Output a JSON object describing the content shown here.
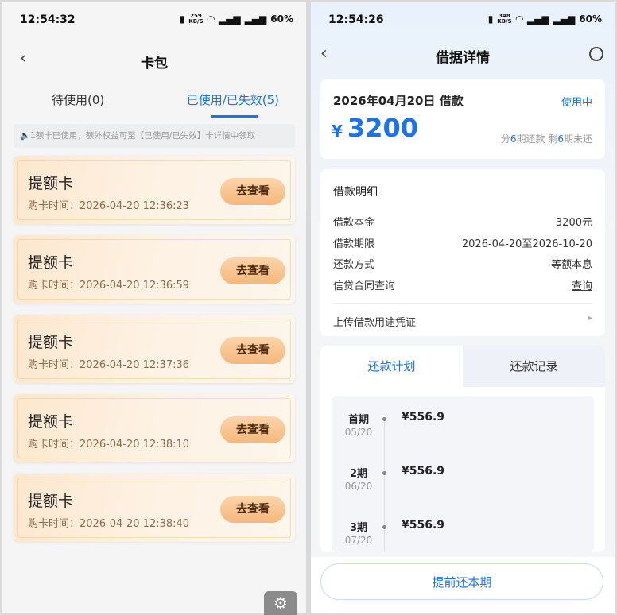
{
  "left": {
    "status": {
      "time": "12:54:32",
      "speed_top": "259",
      "speed_bottom": "KB/S",
      "battery": "60%"
    },
    "nav": {
      "back": "‹",
      "title": "卡包"
    },
    "tabs": {
      "unused": "待使用(0)",
      "used": "已使用/已失效(5)"
    },
    "notice": "🔈1额卡已使用，额外权益可至【已使用/已失效】卡详情中领取",
    "cards": [
      {
        "name": "提额卡",
        "time": "购卡时间：2026-04-20 12:36:23",
        "button": "去查看"
      },
      {
        "name": "提额卡",
        "time": "购卡时间：2026-04-20 12:36:59",
        "button": "去查看"
      },
      {
        "name": "提额卡",
        "time": "购卡时间：2026-04-20 12:37:36",
        "button": "去查看"
      },
      {
        "name": "提额卡",
        "time": "购卡时间：2026-04-20 12:38:10",
        "button": "去查看"
      },
      {
        "name": "提额卡",
        "time": "购卡时间：2026-04-20 12:38:40",
        "button": "去查看"
      }
    ]
  },
  "right": {
    "status": {
      "time": "12:54:26",
      "speed_top": "348",
      "speed_bottom": "KB/S",
      "battery": "60%"
    },
    "nav": {
      "back": "‹",
      "title": "借据详情"
    },
    "summary": {
      "date": "2026年04月20日 借款",
      "status": "使用中",
      "currency": "¥",
      "amount": "3200",
      "terms_prefix": "分",
      "terms_total": "6",
      "terms_mid": "期还款 剩",
      "terms_left": "6",
      "terms_suffix": "期未还"
    },
    "detail": {
      "title": "借款明细",
      "rows": [
        {
          "label": "借款本金",
          "value": "3200元"
        },
        {
          "label": "借款期限",
          "value": "2026-04-20至2026-10-20"
        },
        {
          "label": "还款方式",
          "value": "等额本息"
        },
        {
          "label": "信贷合同查询",
          "value": "查询"
        }
      ],
      "upload": "上传借款用途凭证",
      "upload_arrow": "▸"
    },
    "plan_tabs": {
      "plan": "还款计划",
      "record": "还款记录"
    },
    "plan": [
      {
        "period": "首期",
        "date": "05/20",
        "amount": "¥556.9"
      },
      {
        "period": "2期",
        "date": "06/20",
        "amount": "¥556.9"
      },
      {
        "period": "3期",
        "date": "07/20",
        "amount": "¥556.9"
      }
    ],
    "repay_button": "提前还本期"
  },
  "icons": {
    "vibrate": "vibrate-icon",
    "wifi": "wifi-icon",
    "signal": "signal-icon",
    "settings": "gear-icon",
    "headset": "headset-icon"
  },
  "colors": {
    "accent": "#1a73e8",
    "card_button": "#f6b77c"
  }
}
